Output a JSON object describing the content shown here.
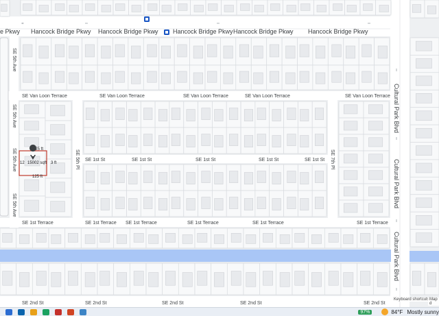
{
  "streets": {
    "hancock": "Hancock Bridge Pkwy",
    "van_loon": "SE Van Loon Terrace",
    "first_st": "SE 1st St",
    "first_terrace": "SE 1st Terrace",
    "second_st": "SE 2nd St",
    "fifth_ave": "SE 5th Ave",
    "fifth_pl": "SE 5th Pl",
    "seventh_pl": "SE 7th Pl",
    "cultural_park": "Cultural Park Blvd",
    "hancock_left_partial": "e Pkwy"
  },
  "parcel": {
    "top_dim": "125 ft",
    "bottom_dim": "125 ft",
    "left_dim": "12",
    "right_dim": "3 ft",
    "area": "15002 sqft"
  },
  "attribution": {
    "shortcuts": "Keyboard shortcuts",
    "map_data": "Map d"
  },
  "taskbar": {
    "battery": "97%",
    "weather": "84°F",
    "weather_desc": "Mostly sunny"
  },
  "colors": {
    "road": "#ffffff",
    "water": "#a9c6f6",
    "parcel_outline": "#c0392b",
    "highway_shield": "#1a56c4"
  }
}
